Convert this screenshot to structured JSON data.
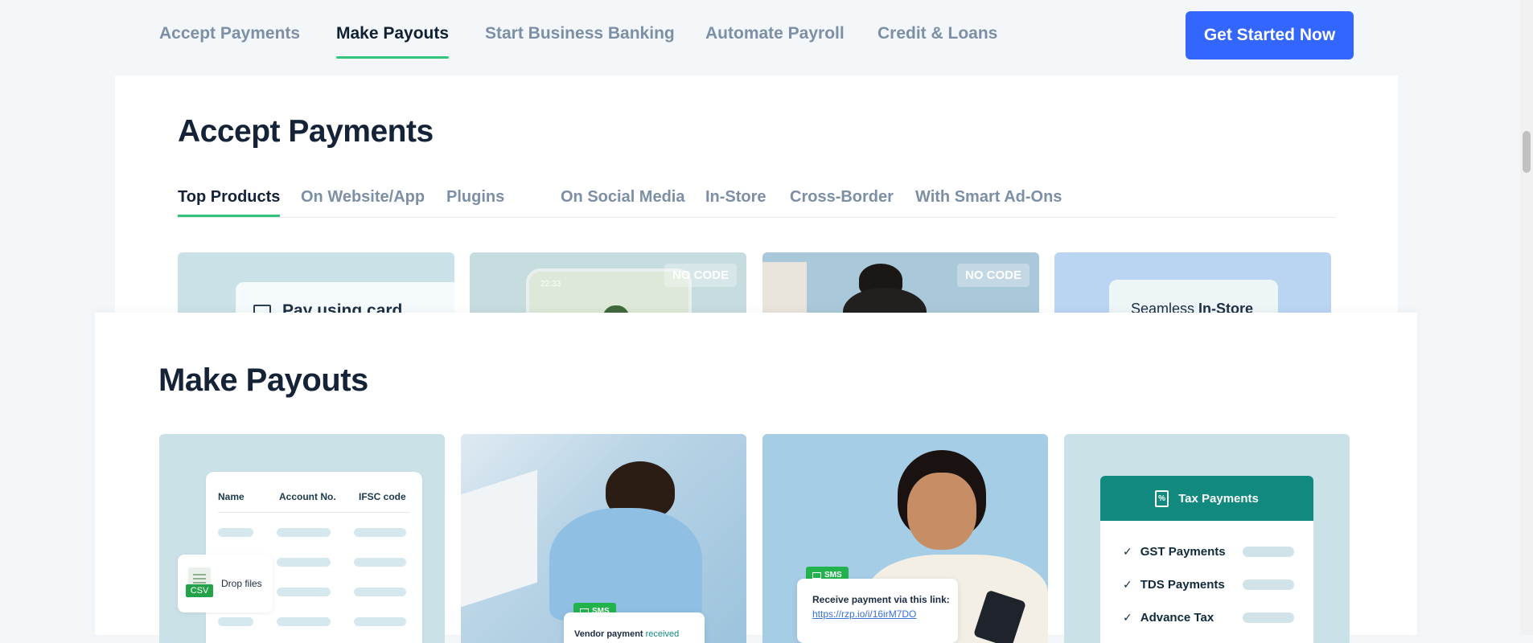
{
  "topnav": {
    "items": [
      {
        "label": "Accept Payments",
        "active": false
      },
      {
        "label": "Make Payouts",
        "active": true
      },
      {
        "label": "Start Business Banking",
        "active": false
      },
      {
        "label": "Automate Payroll",
        "active": false
      },
      {
        "label": "Credit & Loans",
        "active": false
      }
    ],
    "cta_label": "Get Started Now"
  },
  "accept_payments": {
    "title": "Accept Payments",
    "tabs": [
      {
        "label": "Top Products",
        "active": true
      },
      {
        "label": "On Website/App",
        "active": false
      },
      {
        "label": "Plugins",
        "active": false
      },
      {
        "label": "On Social Media",
        "active": false
      },
      {
        "label": "In-Store",
        "active": false
      },
      {
        "label": "Cross-Border",
        "active": false
      },
      {
        "label": "With Smart Ad-Ons",
        "active": false
      }
    ],
    "tiles": {
      "card_text": "Pay using card",
      "phone_time": "22:33",
      "badge": "NO CODE",
      "instore_text_plain": "Seamless",
      "instore_text_bold": "In-Store"
    }
  },
  "make_payouts": {
    "title": "Make Payouts",
    "bulk": {
      "headers": [
        "Name",
        "Account No.",
        "IFSC code"
      ],
      "drop_label": "Drop files",
      "file_type": "CSV"
    },
    "vendor": {
      "sms_label": "SMS",
      "message_bold": "Vendor payment",
      "message_rest": "received"
    },
    "link": {
      "sms_label": "SMS",
      "message": "Receive payment via this link:",
      "url": "https://rzp.io/i/16irM7DO"
    },
    "tax": {
      "title": "Tax Payments",
      "items": [
        "GST Payments",
        "TDS Payments",
        "Advance Tax"
      ]
    }
  },
  "colors": {
    "accent_blue": "#3366ff",
    "active_underline": "#33c37a",
    "tax_header": "#12897f",
    "sms_green": "#22b34c"
  }
}
